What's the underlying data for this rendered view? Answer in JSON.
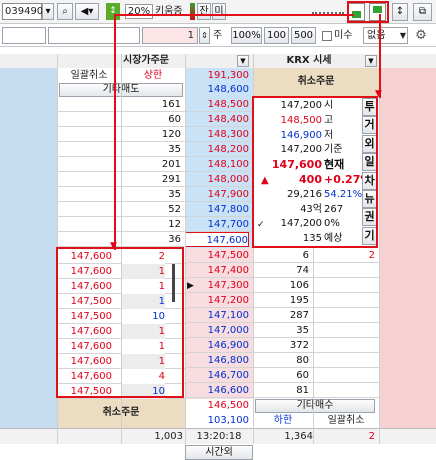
{
  "toolbar1": {
    "code": "039490",
    "unit_label": "20%",
    "name_text": "키움증",
    "mode_a": "잔",
    "mode_b": "미"
  },
  "toolbar2": {
    "amount": "1",
    "unit": "주",
    "pct": "100%",
    "q100": "100",
    "q500": "500",
    "misu": "미수",
    "none": "없음"
  },
  "header": {
    "left_title": "시장가주문",
    "right_title": "KRX 시세",
    "cancel_all": "일괄취소",
    "upper": "상한",
    "upper_price": "191,300",
    "other_sell": "기타매도",
    "other_sell_price": "148,600",
    "cancel_order": "취소주문"
  },
  "sell_rows": [
    {
      "qty": "161",
      "price": "148,500"
    },
    {
      "qty": "60",
      "price": "148,400"
    },
    {
      "qty": "120",
      "price": "148,300"
    },
    {
      "qty": "35",
      "price": "148,200"
    },
    {
      "qty": "201",
      "price": "148,100"
    },
    {
      "qty": "291",
      "price": "148,000"
    },
    {
      "qty": "35",
      "price": "147,900"
    },
    {
      "qty": "52",
      "price": "147,800"
    },
    {
      "qty": "12",
      "price": "147,700"
    },
    {
      "qty": "36",
      "price": "147,600"
    }
  ],
  "quote": {
    "rows": [
      {
        "v": "147,200",
        "l": "시"
      },
      {
        "v": "148,500",
        "l": "고"
      },
      {
        "v": "146,900",
        "l": "저"
      },
      {
        "v": "147,200",
        "l": "기준"
      },
      {
        "v": "147,600",
        "l": "현재"
      },
      {
        "v": "400",
        "l": "+0.27%"
      },
      {
        "v": "29,216",
        "l": "54.21%"
      },
      {
        "v": "43억",
        "l": "267"
      },
      {
        "v": "147,200",
        "l": "0%"
      },
      {
        "v": "135",
        "l": "예상"
      }
    ],
    "side": [
      "투",
      "거",
      "외",
      "일",
      "차",
      "뉴",
      "권",
      "기"
    ]
  },
  "buy_rows": [
    {
      "price": "147,500",
      "qty": "6",
      "left": "2"
    },
    {
      "price": "147,400",
      "qty": "74"
    },
    {
      "price": "147,300",
      "qty": "106"
    },
    {
      "price": "147,200",
      "qty": "195"
    },
    {
      "price": "147,100",
      "qty": "287"
    },
    {
      "price": "147,000",
      "qty": "35"
    },
    {
      "price": "146,900",
      "qty": "372"
    },
    {
      "price": "146,800",
      "qty": "80"
    },
    {
      "price": "146,700",
      "qty": "60"
    },
    {
      "price": "146,600",
      "qty": "81"
    }
  ],
  "orders": [
    {
      "price": "147,600",
      "qty": "2"
    },
    {
      "price": "147,600",
      "qty": "1"
    },
    {
      "price": "147,600",
      "qty": "1"
    },
    {
      "price": "147,500",
      "qty": "1"
    },
    {
      "price": "147,500",
      "qty": "10"
    },
    {
      "price": "147,600",
      "qty": "1"
    },
    {
      "price": "147,600",
      "qty": "1"
    },
    {
      "price": "147,600",
      "qty": "1"
    },
    {
      "price": "147,600",
      "qty": "4"
    },
    {
      "price": "147,500",
      "qty": "10"
    }
  ],
  "footer": {
    "cancel_order": "취소주문",
    "other_buy_price": "146,500",
    "other_buy": "기타매수",
    "lower_price": "103,100",
    "lower": "하한",
    "cancel_all": "일괄취소",
    "total_sell": "1,003",
    "time": "13:20:18",
    "total_buy": "1,364",
    "diff": "2",
    "after_hours": "시간외"
  }
}
